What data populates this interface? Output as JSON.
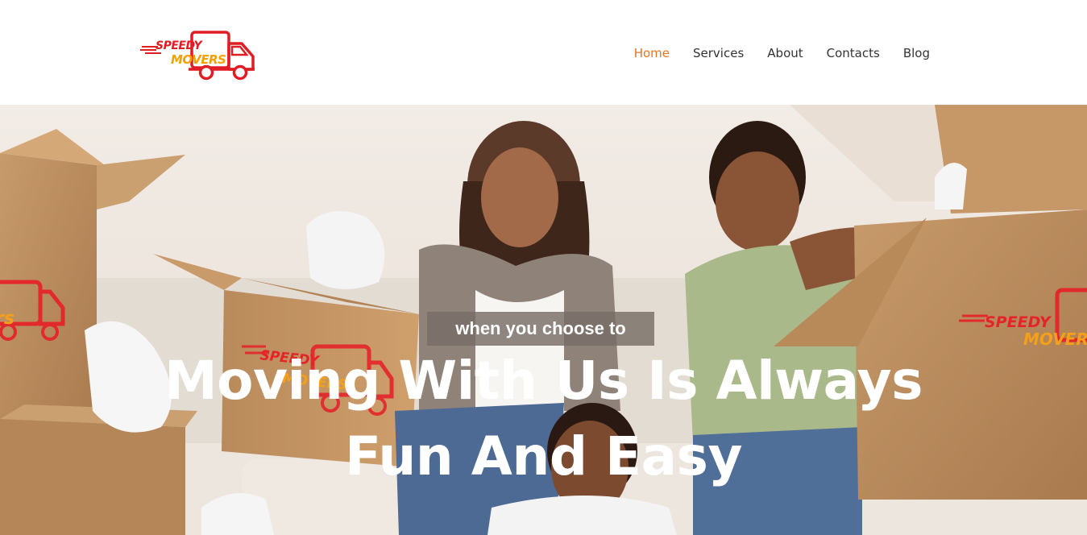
{
  "brand": {
    "logo_word_1": "SPEEDY",
    "logo_word_2": "MOVERS",
    "colors": {
      "red": "#e01c24",
      "orange": "#f5a000"
    },
    "icon": "truck-icon"
  },
  "nav": {
    "items": [
      {
        "label": "Home",
        "active": true
      },
      {
        "label": "Services",
        "active": false
      },
      {
        "label": "About",
        "active": false
      },
      {
        "label": "Contacts",
        "active": false
      },
      {
        "label": "Blog",
        "active": false
      }
    ],
    "active_color": "#e8721c",
    "text_color": "#333333"
  },
  "hero": {
    "tagline": "when you choose to",
    "headline_line_1": "Moving With Us Is Always",
    "headline_line_2": "Fun And Easy",
    "box_brand_word_1": "SPEEDY",
    "box_brand_word_2": "MOVERS",
    "box_brand_partial": "rs"
  }
}
